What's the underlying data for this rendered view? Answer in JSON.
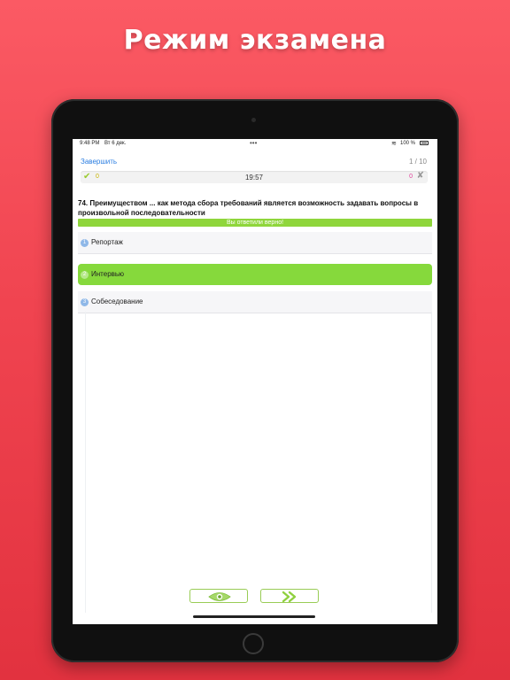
{
  "headline": "Режим экзамена",
  "status_bar": {
    "time": "9:48 PM",
    "date": "Вт 6 дек.",
    "battery": "100 %"
  },
  "nav": {
    "finish_label": "Завершить",
    "progress": "1 / 10"
  },
  "score": {
    "correct_count": "0",
    "timer": "19:57",
    "wrong_count": "0"
  },
  "question": {
    "text": "74. Преимуществом ... как метода сбора требований является возможность задавать вопросы в произвольной последовательности",
    "result": "Вы ответили верно!"
  },
  "options": [
    {
      "num": "1",
      "label": "Репортаж",
      "selected": false
    },
    {
      "num": "2",
      "label": "Интервью",
      "selected": true
    },
    {
      "num": "3",
      "label": "Собеседование",
      "selected": false
    }
  ],
  "colors": {
    "background": "#f04450",
    "accent_green": "#86d93c",
    "link_blue": "#2a7de1"
  },
  "icons": {
    "show_answer": "eye-icon",
    "next": "double-chevron-right-icon"
  }
}
